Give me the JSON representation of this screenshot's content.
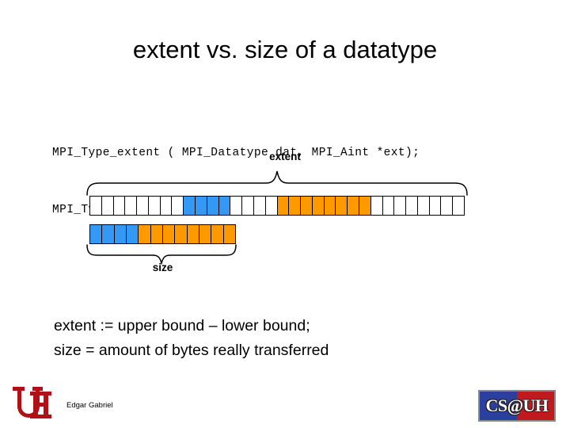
{
  "slide": {
    "title": "extent vs. size of a datatype",
    "background_color": "#ffffff"
  },
  "code": {
    "lines": [
      "MPI_Type_extent ( MPI_Datatype dat, MPI_Aint *ext);",
      "MPI_Type_size ( MPI_Datatype dat, int *size );"
    ]
  },
  "diagram": {
    "extent_label": "extent",
    "size_label": "size",
    "colors": {
      "blue": "#3399f5",
      "orange": "#ff9900",
      "white": "#ffffff",
      "outline": "#000000"
    },
    "extent_row": {
      "total_cells": 32,
      "segments": [
        {
          "color": "white",
          "count": 8
        },
        {
          "color": "blue",
          "count": 4
        },
        {
          "color": "white",
          "count": 4
        },
        {
          "color": "orange",
          "count": 8
        },
        {
          "color": "white",
          "count": 8
        }
      ]
    },
    "size_row": {
      "total_cells": 12,
      "segments": [
        {
          "color": "blue",
          "count": 4
        },
        {
          "color": "orange",
          "count": 8
        }
      ]
    }
  },
  "definitions": {
    "lines": [
      "extent := upper bound – lower bound;",
      "size =  amount of bytes really transferred"
    ]
  },
  "footer": {
    "author": "Edgar Gabriel",
    "uh_logo_alt": "uh-logo",
    "uh_logo_color": "#b01116",
    "csuh_logo_text": "CS@UH",
    "csuh_blue": "#2b3f9e",
    "csuh_red": "#c01a1f"
  }
}
